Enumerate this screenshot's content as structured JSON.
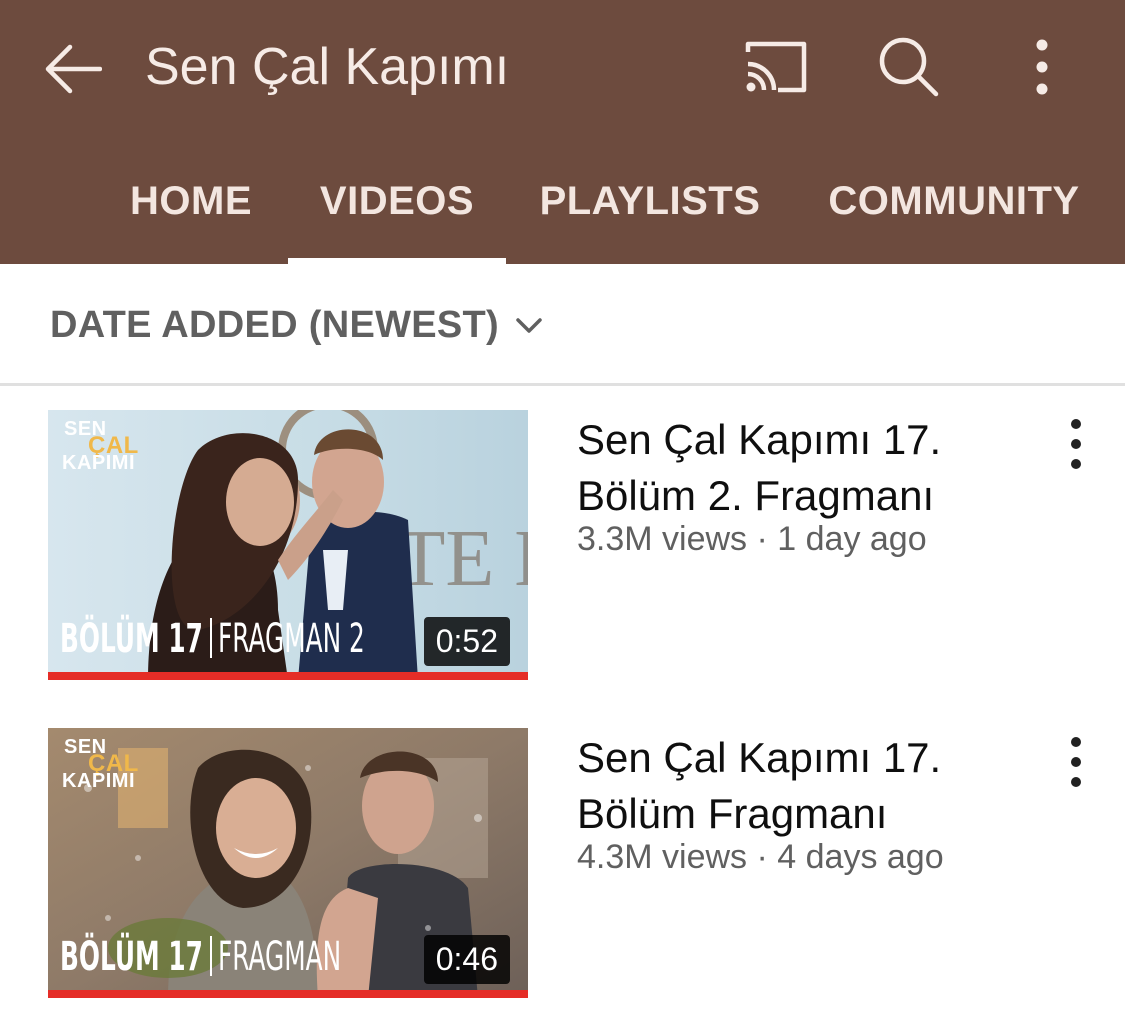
{
  "header": {
    "back_icon": "arrow-left-icon",
    "title": "Sen Çal Kapımı",
    "cast_icon": "cast-icon",
    "search_icon": "search-icon",
    "more_icon": "more-vertical-icon",
    "background_color": "#6d4b3e"
  },
  "tabs": [
    {
      "label": "HOME",
      "active": false
    },
    {
      "label": "VIDEOS",
      "active": true
    },
    {
      "label": "PLAYLISTS",
      "active": false
    },
    {
      "label": "COMMUNITY",
      "active": false
    }
  ],
  "sort": {
    "label": "DATE ADDED (NEWEST)",
    "icon": "chevron-down-icon"
  },
  "videos": [
    {
      "title": "Sen Çal Kapımı 17. Bölüm 2. Fragmanı",
      "meta": "3.3M views · 1 day ago",
      "duration": "0:52",
      "thumb_logo": {
        "line1": "SEN",
        "line2": "ÇAL",
        "line3": "KAPIMI"
      },
      "thumb_caption_left": "BÖLÜM 17",
      "thumb_caption_right": "FRAGMAN 2",
      "watched_fraction": 1.0
    },
    {
      "title": "Sen Çal Kapımı 17. Bölüm Fragmanı",
      "meta": "4.3M views · 4 days ago",
      "duration": "0:46",
      "thumb_logo": {
        "line1": "SEN",
        "line2": "ÇAL",
        "line3": "KAPIMI"
      },
      "thumb_caption_left": "BÖLÜM 17",
      "thumb_caption_right": "FRAGMAN",
      "watched_fraction": 1.0
    }
  ],
  "colors": {
    "accent": "#e52d27",
    "header_text": "#f6ebe6"
  }
}
